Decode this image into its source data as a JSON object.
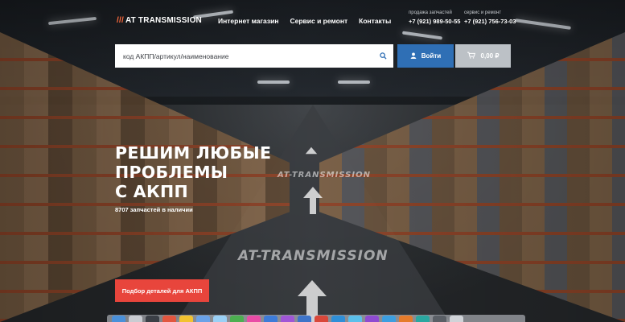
{
  "header": {
    "logo": {
      "slashes": "///",
      "text": "AT TRANSMISSION"
    },
    "nav": [
      "Интернет магазин",
      "Сервис и ремонт",
      "Контакты"
    ],
    "phones": [
      {
        "caption": "продажа запчастей",
        "number": "+7 (921) 989-50-55"
      },
      {
        "caption": "сервис и ремонт",
        "number": "+7 (921) 756-73-03"
      }
    ]
  },
  "search": {
    "placeholder": "код АКПП/артикул/наименование",
    "icon": "search-icon"
  },
  "login": {
    "label": "Войти",
    "icon": "user-icon"
  },
  "cart": {
    "label": "0,00 ₽",
    "icon": "cart-icon"
  },
  "hero": {
    "title_lines": [
      "РЕШИМ ЛЮБЫЕ",
      "ПРОБЛЕМЫ",
      "С АКПП"
    ],
    "subtitle": "8707 запчастей в наличии",
    "cta": "Подбор деталей для АКПП"
  },
  "background": {
    "floor_text_1": "AT-TRANSMISSION",
    "floor_text_2": "AT-TRANSMISSION"
  },
  "colors": {
    "accent_orange": "#ff6a3d",
    "login_blue": "#2f6fb5",
    "cart_gray": "#bcc1c6",
    "cta_red": "#e8453c"
  },
  "dock": {
    "icons": [
      "finder-icon",
      "launchpad-icon",
      "app-icon",
      "app-icon",
      "app-icon",
      "app-icon",
      "app-icon",
      "app-icon",
      "app-icon",
      "app-icon",
      "app-icon",
      "app-icon",
      "app-icon",
      "app-icon",
      "app-icon",
      "app-icon",
      "app-icon",
      "app-icon",
      "app-icon",
      "app-icon",
      "app-icon",
      "app-icon",
      "app-icon",
      "app-icon",
      "trash-icon"
    ]
  }
}
